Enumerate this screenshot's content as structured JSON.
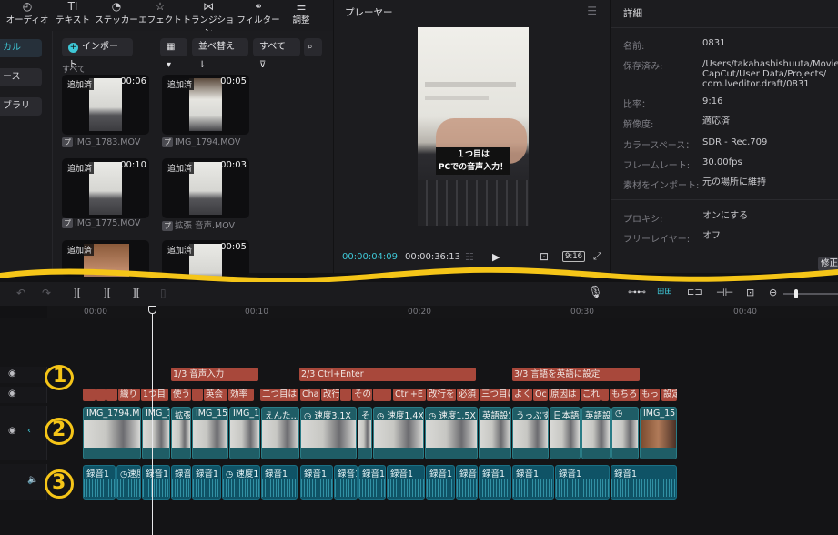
{
  "toolbar": {
    "items": [
      {
        "label": "オーディオ",
        "icon": "audio-icon"
      },
      {
        "label": "テキスト",
        "icon": "text-icon"
      },
      {
        "label": "ステッカー",
        "icon": "sticker-icon"
      },
      {
        "label": "エフェクト",
        "icon": "effect-icon"
      },
      {
        "label": "トランジション",
        "icon": "transition-icon"
      },
      {
        "label": "フィルター",
        "icon": "filter-icon"
      },
      {
        "label": "調整",
        "icon": "adjust-icon"
      }
    ],
    "text_glyph": "TI"
  },
  "sidebar": {
    "items": [
      {
        "label": "カル"
      },
      {
        "label": "ース"
      },
      {
        "label": "ブラリ"
      }
    ]
  },
  "media": {
    "import_label": "インポート",
    "sort_label": "並べ替え",
    "filter_label": "すべて",
    "section_label": "すべて",
    "clips": [
      {
        "tag": "追加済",
        "duration": "00:06",
        "name": "IMG_1783.MOV"
      },
      {
        "tag": "追加済",
        "duration": "00:05",
        "name": "IMG_1794.MOV"
      },
      {
        "tag": "追加済",
        "duration": "00:10",
        "name": "IMG_1775.MOV"
      },
      {
        "tag": "追加済",
        "duration": "00:03",
        "name": "拡張 音声.MOV"
      },
      {
        "tag": "追加済",
        "duration": "",
        "name": ""
      },
      {
        "tag": "追加済",
        "duration": "00:05",
        "name": ""
      }
    ],
    "file_badge": "プ"
  },
  "player": {
    "title": "プレーヤー",
    "caption_line1": "１つ目は",
    "caption_line2": "PCでの音声入力！",
    "current_time": "00:00:04:09",
    "total_time": "00:00:36:13",
    "ratio_label": "9:16"
  },
  "details": {
    "title": "詳細",
    "rows": [
      {
        "label": "名前:",
        "value": "0831"
      },
      {
        "label": "保存済み:",
        "value_lines": [
          "/Users/takahashishuuta/Movies",
          "CapCut/User Data/Projects/",
          "com.lveditor.draft/0831"
        ]
      },
      {
        "label": "比率：",
        "value": "9:16"
      },
      {
        "label": "解像度:",
        "value": "適応済"
      },
      {
        "label": "カラースペース：",
        "value": "SDR - Rec.709"
      },
      {
        "label": "フレームレート:",
        "value": "30.00fps"
      },
      {
        "label": "素材をインポート:",
        "value": "元の場所に維持"
      },
      {
        "label": "プロキシ:",
        "value": "オンにする"
      },
      {
        "label": "フリーレイヤー:",
        "value": "オフ"
      }
    ],
    "modify_label": "修正"
  },
  "ruler": {
    "ticks": [
      "00:00",
      "00:10",
      "00:20",
      "00:30",
      "00:40"
    ]
  },
  "timeline": {
    "chapters": [
      {
        "label": "1/3 音声入力"
      },
      {
        "label": "2/3 Ctrl+Enter"
      },
      {
        "label": "3/3 言語を英語に設定"
      }
    ],
    "captions": [
      {
        "label": ""
      },
      {
        "label": ""
      },
      {
        "label": ""
      },
      {
        "label": "織り"
      },
      {
        "label": "1つ目"
      },
      {
        "label": "使う"
      },
      {
        "label": ""
      },
      {
        "label": "英会"
      },
      {
        "label": "効率"
      },
      {
        "label": "二つ目は"
      },
      {
        "label": "Cha"
      },
      {
        "label": "改行"
      },
      {
        "label": ""
      },
      {
        "label": "その"
      },
      {
        "label": ""
      },
      {
        "label": "Ctrl+E"
      },
      {
        "label": "改行を"
      },
      {
        "label": "必須"
      },
      {
        "label": "三つ目は"
      },
      {
        "label": "よく"
      },
      {
        "label": "Oc"
      },
      {
        "label": "原因は"
      },
      {
        "label": "これ"
      },
      {
        "label": ""
      },
      {
        "label": "もちろ"
      },
      {
        "label": "もっ"
      },
      {
        "label": "設定"
      }
    ],
    "video_clips": [
      {
        "label": "IMG_1794.MO"
      },
      {
        "label": "IMG_1"
      },
      {
        "label": "拡張"
      },
      {
        "label": "IMG_15"
      },
      {
        "label": "IMG_17"
      },
      {
        "label": "えんた…"
      },
      {
        "label": "速度3.1X"
      },
      {
        "label": "そ"
      },
      {
        "label": "速度1.4X"
      },
      {
        "label": "速度1.5X"
      },
      {
        "label": "英語設定"
      },
      {
        "label": "うっぷす"
      },
      {
        "label": "日本語入"
      },
      {
        "label": "英語設"
      },
      {
        "label": ""
      },
      {
        "label": "IMG_15"
      }
    ],
    "audio_clips": [
      {
        "label": "録音1"
      },
      {
        "label": "速度"
      },
      {
        "label": "録音1"
      },
      {
        "label": "録音"
      },
      {
        "label": "録音1"
      },
      {
        "label": "速度1."
      },
      {
        "label": "録音1"
      },
      {
        "label": "録音1"
      },
      {
        "label": "録音1"
      },
      {
        "label": "録音1"
      },
      {
        "label": "録音1"
      },
      {
        "label": "録音1"
      },
      {
        "label": "録音1"
      },
      {
        "label": "録音1"
      },
      {
        "label": "録音1"
      },
      {
        "label": "録音1"
      },
      {
        "label": "録音1"
      }
    ],
    "annotations": [
      "1",
      "2",
      "3"
    ]
  },
  "colors": {
    "accent": "#3ec7d6",
    "caption_clip": "#a8483b",
    "video_clip": "#1f5d66",
    "audio_clip": "#0f5366",
    "marker": "#f5c518"
  }
}
